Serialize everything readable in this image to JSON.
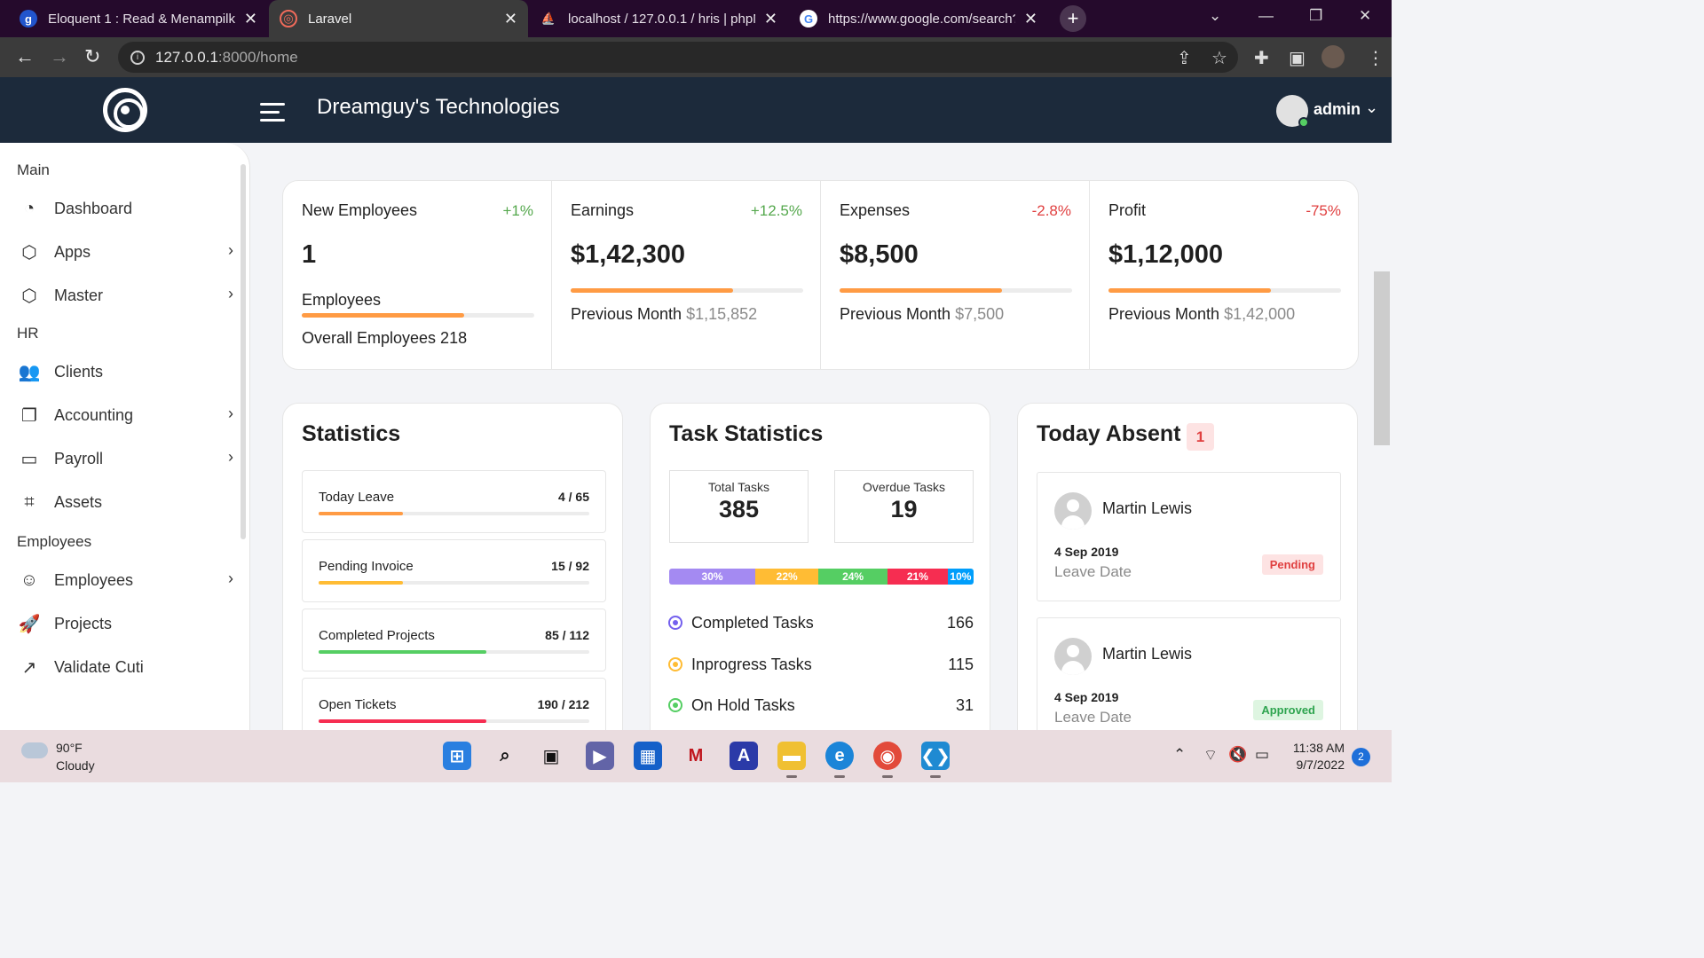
{
  "browser": {
    "tabs": [
      {
        "title": "Eloquent 1 : Read & Menampilka",
        "icon": "g"
      },
      {
        "title": "Laravel",
        "icon": "L"
      },
      {
        "title": "localhost / 127.0.0.1 / hris | phpM",
        "icon": "pma"
      },
      {
        "title": "https://www.google.com/search?",
        "icon": "G"
      }
    ],
    "url_host": "127.0.0.1",
    "url_path": ":8000/home"
  },
  "header": {
    "company": "Dreamguy's Technologies",
    "user": "admin"
  },
  "sidebar": {
    "sections": [
      "Main",
      "HR",
      "Employees"
    ],
    "items": [
      {
        "label": "Dashboard",
        "icon": "dashboard-icon"
      },
      {
        "label": "Apps",
        "icon": "cube-icon"
      },
      {
        "label": "Master",
        "icon": "cube-icon"
      },
      {
        "label": "Clients",
        "icon": "users-icon"
      },
      {
        "label": "Accounting",
        "icon": "files-icon"
      },
      {
        "label": "Payroll",
        "icon": "money-icon"
      },
      {
        "label": "Assets",
        "icon": "crop-icon"
      },
      {
        "label": "Employees",
        "icon": "user-icon"
      },
      {
        "label": "Projects",
        "icon": "rocket-icon"
      },
      {
        "label": "Validate Cuti",
        "icon": "external-link-icon"
      }
    ]
  },
  "summary": [
    {
      "label": "New Employees",
      "change": "+1%",
      "value": "1",
      "progress": 0.7,
      "sub_label": "Employees",
      "sub2_label": "Overall Employees 218"
    },
    {
      "label": "Earnings",
      "change": "+12.5%",
      "value": "$1,42,300",
      "progress": 0.7,
      "prev_label": "Previous Month",
      "prev_value": "$1,15,852"
    },
    {
      "label": "Expenses",
      "change": "-2.8%",
      "value": "$8,500",
      "progress": 0.7,
      "prev_label": "Previous Month",
      "prev_value": "$7,500"
    },
    {
      "label": "Profit",
      "change": "-75%",
      "value": "$1,12,000",
      "progress": 0.7,
      "prev_label": "Previous Month",
      "prev_value": "$1,42,000"
    }
  ],
  "statistics": {
    "title": "Statistics",
    "rows": [
      {
        "label": "Today Leave",
        "value": "4 / 65",
        "progress": 0.31,
        "color": "#ff9b44"
      },
      {
        "label": "Pending Invoice",
        "value": "15 / 92",
        "progress": 0.31,
        "color": "#ffbc34"
      },
      {
        "label": "Completed Projects",
        "value": "85 / 112",
        "progress": 0.62,
        "color": "#55ce63"
      },
      {
        "label": "Open Tickets",
        "value": "190 / 212",
        "progress": 0.62,
        "color": "#f62d51"
      }
    ]
  },
  "tasks": {
    "title": "Task Statistics",
    "total_label": "Total Tasks",
    "total": "385",
    "overdue_label": "Overdue Tasks",
    "overdue": "19",
    "segments": [
      {
        "label": "30%",
        "share": 0.3,
        "color": "#a48af2"
      },
      {
        "label": "22%",
        "share": 0.22,
        "color": "#ffbc34"
      },
      {
        "label": "24%",
        "share": 0.24,
        "color": "#55ce63"
      },
      {
        "label": "21%",
        "share": 0.21,
        "color": "#f62d51"
      },
      {
        "label": "10%",
        "share": 0.09,
        "color": "#009efb"
      }
    ],
    "lines": [
      {
        "label": "Completed Tasks",
        "count": "166",
        "color": "#7460ee"
      },
      {
        "label": "Inprogress Tasks",
        "count": "115",
        "color": "#ffbc34"
      },
      {
        "label": "On Hold Tasks",
        "count": "31",
        "color": "#55ce63"
      }
    ]
  },
  "absent": {
    "title": "Today Absent",
    "count": "1",
    "entries": [
      {
        "name": "Martin Lewis",
        "date": "4 Sep 2019",
        "date_label": "Leave Date",
        "status": "Pending",
        "status_bg": "#fde3e3",
        "status_fg": "#e04040"
      },
      {
        "name": "Martin Lewis",
        "date": "4 Sep 2019",
        "date_label": "Leave Date",
        "status": "Approved",
        "status_bg": "#def5e1",
        "status_fg": "#2ea44f"
      }
    ]
  },
  "taskbar": {
    "temp": "90°F",
    "weather": "Cloudy",
    "time": "11:38 AM",
    "date": "9/7/2022",
    "notifications": "2"
  }
}
